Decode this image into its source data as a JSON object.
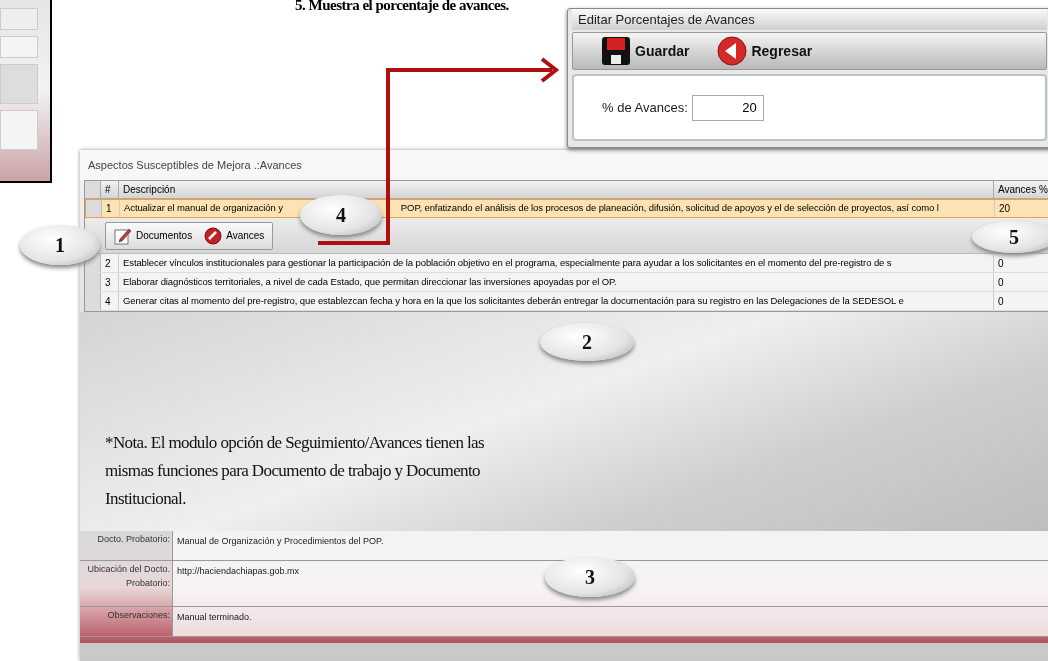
{
  "caption": "5. Muestra el porcentaje  de avances.",
  "popup": {
    "title": "Editar Porcentajes de Avances",
    "toolbar": [
      {
        "kind": "save",
        "label": "Guardar"
      },
      {
        "kind": "back",
        "label": "Regresar"
      }
    ],
    "field": {
      "label": "% de Avances:",
      "value": "20"
    }
  },
  "main": {
    "title": "Aspectos Susceptibles de Mejora .:Avances",
    "columns": [
      "#",
      "Descripción",
      "Avances %"
    ],
    "rows": [
      {
        "number": "1",
        "description_parts": [
          "Actualizar el manual de organización y",
          "POP, enfatizando el análisis de los procesos de planeación, difusión, solicitud de apoyos y el de selección de proyectos, así como l"
        ],
        "avances": "20",
        "selected": true,
        "expanded": true
      },
      {
        "number": "2",
        "description_parts": [
          "Establecer vínculos institucionales para gestionar la participación de la población objetivo en el programa, especialmente para ayudar a los solicitantes en el momento del pre-registro de s"
        ],
        "avances": "0",
        "selected": false,
        "expanded": false
      },
      {
        "number": "3",
        "description_parts": [
          "Elaborar diagnósticos territoriales, a nivel de cada Estado, que permitan direccionar las inversiones apoyadas por el OP."
        ],
        "avances": "0",
        "selected": false,
        "expanded": false
      },
      {
        "number": "4",
        "description_parts": [
          "Generar citas al momento del pre-registro, que establezcan fecha y hora en la que los solicitantes deberán entregar la documentación para su registro en las Delegaciones de la SEDESOL e"
        ],
        "avances": "0",
        "selected": false,
        "expanded": false
      }
    ],
    "detail_toolbar": [
      {
        "kind": "documents",
        "label": "Documentos"
      },
      {
        "kind": "progress",
        "label": "Avances"
      }
    ],
    "note": "*Nota. El modulo opción de Seguimiento/Avances tienen las mismas funciones para Documento de trabajo y Documento Institucional.",
    "form": [
      {
        "label": "Docto. Probatorio:",
        "value": "Manual de Organización y Procedimientos del POP."
      },
      {
        "label": "Ubicación del Docto. Probatorio:",
        "value": "http://haciendachiapas.gob.mx"
      },
      {
        "label": "Observaciones:",
        "value": "Manual terminado."
      }
    ]
  },
  "callouts": [
    {
      "label": "1"
    },
    {
      "label": "4"
    },
    {
      "label": "5"
    },
    {
      "label": "2"
    },
    {
      "label": "3"
    }
  ]
}
